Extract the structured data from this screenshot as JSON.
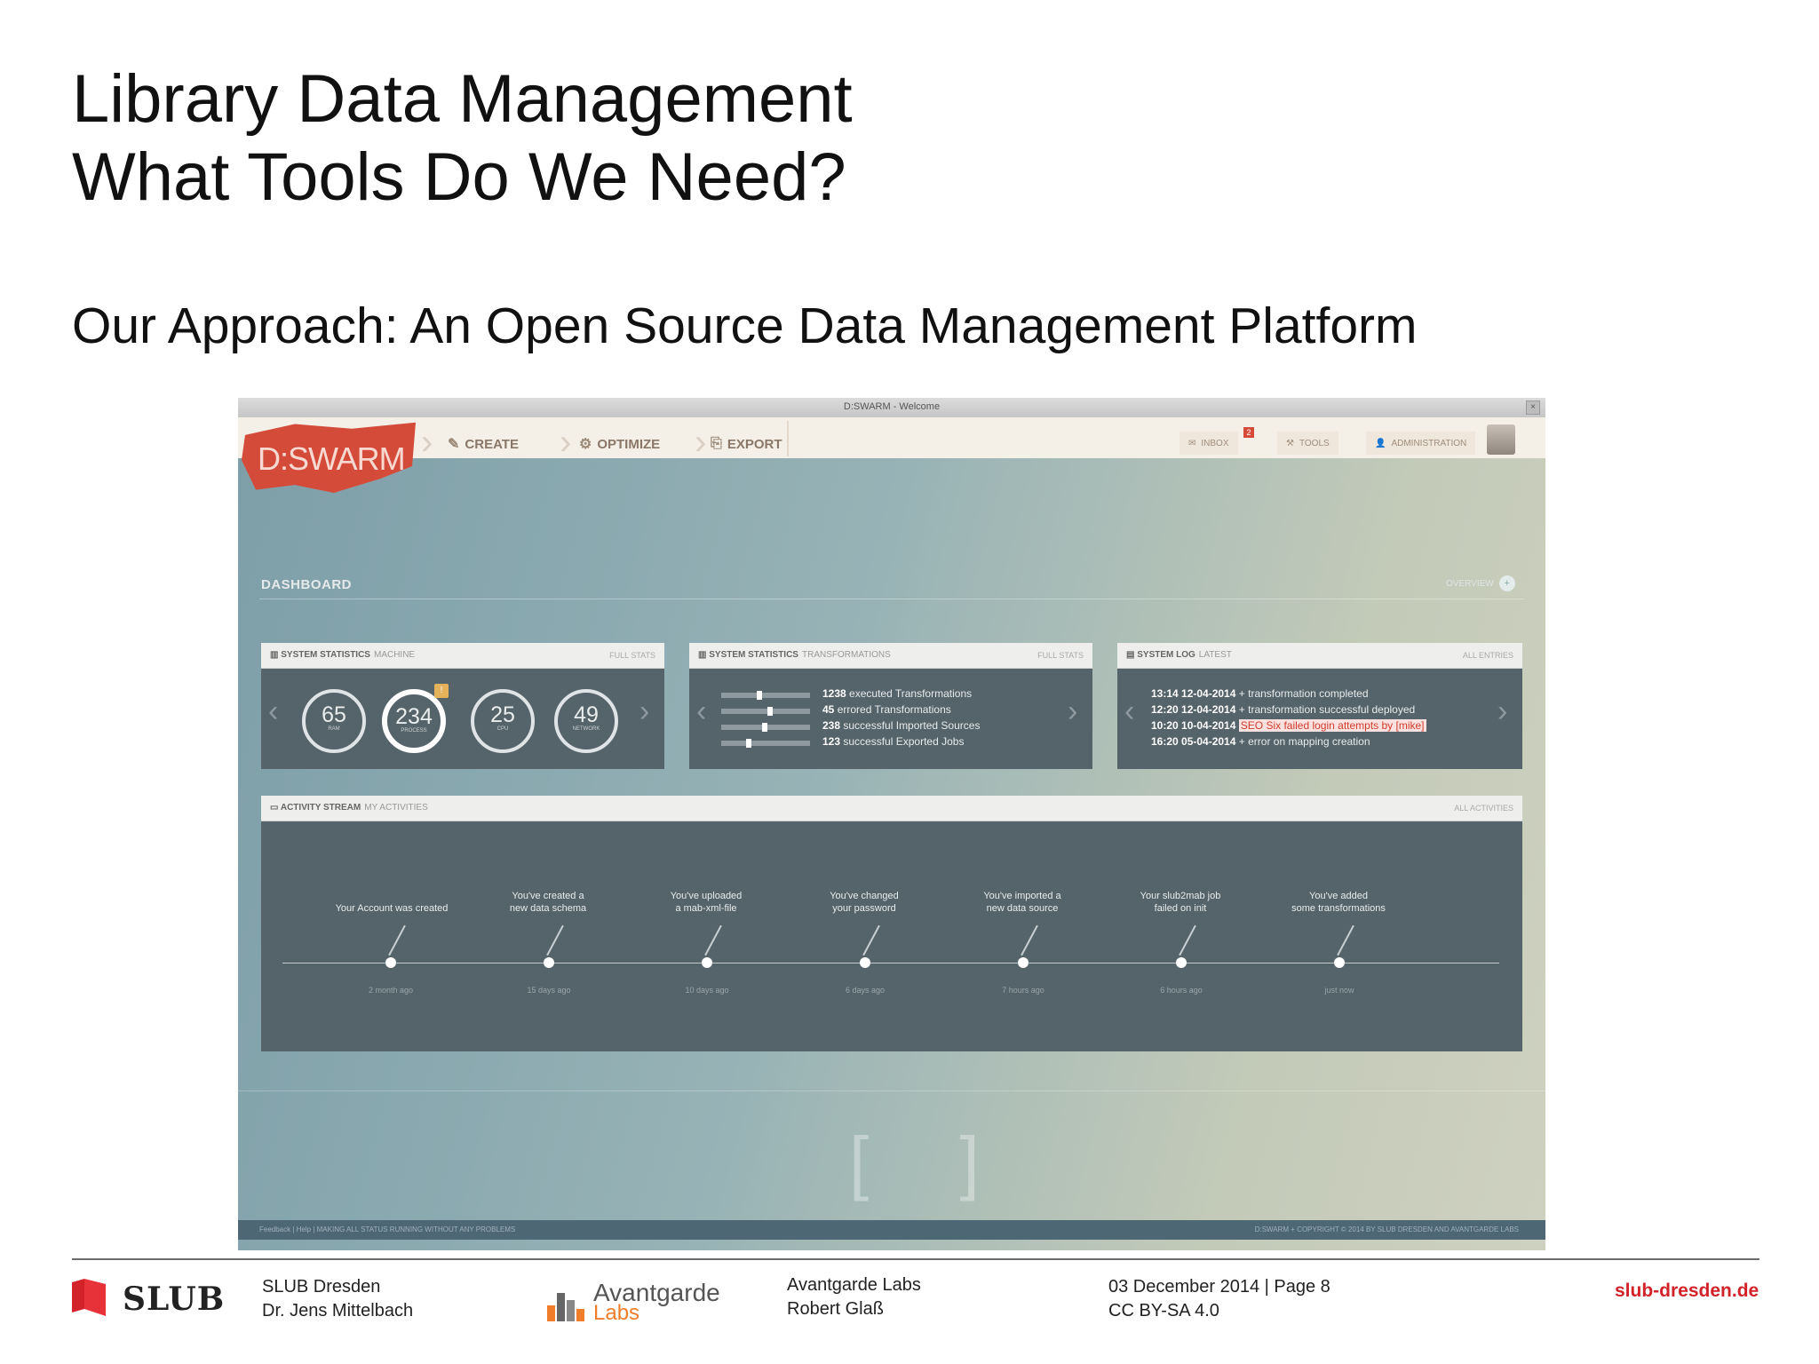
{
  "slide": {
    "title_line1": "Library Data Management",
    "title_line2": "What Tools Do We Need?",
    "subtitle": "Our Approach: An Open Source Data Management Platform"
  },
  "app": {
    "window_title": "D:SWARM - Welcome",
    "close_symbol": "×",
    "logo": "D:SWARM",
    "nav": [
      {
        "label": "CREATE",
        "icon": "pencil-icon"
      },
      {
        "label": "OPTIMIZE",
        "icon": "gears-icon"
      },
      {
        "label": "EXPORT",
        "icon": "export-icon"
      }
    ],
    "menu": {
      "inbox": {
        "label": "INBOX",
        "badge": "2"
      },
      "tools": "TOOLS",
      "admin": "ADMINISTRATION"
    },
    "dashboard": {
      "title": "DASHBOARD",
      "toggle_label": "OVERVIEW",
      "toggle_symbol": "+"
    },
    "machine_panel": {
      "title": "SYSTEM STATISTICS",
      "subtitle": "MACHINE",
      "link": "FULL STATS",
      "gauges": [
        {
          "value": "65",
          "label": "RAM"
        },
        {
          "value": "234",
          "label": "PROCESS",
          "badge": "!"
        },
        {
          "value": "25",
          "label": "CPU"
        },
        {
          "value": "49",
          "label": "NETWORK"
        }
      ]
    },
    "transformation_panel": {
      "title": "SYSTEM STATISTICS",
      "subtitle": "TRANSFORMATIONS",
      "link": "FULL STATS",
      "lines": [
        {
          "count": "1238",
          "text": "executed Transformations"
        },
        {
          "count": "45",
          "text": "errored Transformations"
        },
        {
          "count": "238",
          "text": "successful Imported Sources"
        },
        {
          "count": "123",
          "text": "successful Exported Jobs"
        }
      ]
    },
    "log_panel": {
      "title": "SYSTEM LOG",
      "subtitle": "LATEST",
      "link": "ALL ENTRIES",
      "entries": [
        {
          "time": "13:14 12-04-2014",
          "text": "+ transformation completed",
          "alert": false
        },
        {
          "time": "12:20 12-04-2014",
          "text": "+ transformation successful deployed",
          "alert": false
        },
        {
          "time": "10:20 10-04-2014",
          "text": "SEO Six failed login attempts by [mike]",
          "alert": true
        },
        {
          "time": "16:20 05-04-2014",
          "text": "+ error on mapping creation",
          "alert": false
        }
      ]
    },
    "activity_panel": {
      "title": "ACTIVITY STREAM",
      "subtitle": "MY ACTIVITIES",
      "link": "ALL ACTIVITIES",
      "events": [
        {
          "line1": "Your Account was created",
          "line2": "",
          "time": "2 month ago"
        },
        {
          "line1": "You've created a",
          "line2": "new data schema",
          "time": "15 days ago"
        },
        {
          "line1": "You've uploaded",
          "line2": "a mab-xml-file",
          "time": "10 days ago"
        },
        {
          "line1": "You've changed",
          "line2": "your password",
          "time": "6 days ago"
        },
        {
          "line1": "You've imported a",
          "line2": "new data source",
          "time": "7 hours ago"
        },
        {
          "line1": "Your slub2mab job",
          "line2": "failed on init",
          "time": "6 hours ago"
        },
        {
          "line1": "You've added",
          "line2": "some transformations",
          "time": "just now"
        }
      ]
    },
    "status": {
      "left": "Feedback | Help | MAKING ALL STATUS RUNNING WITHOUT ANY PROBLEMS",
      "right": "D:SWARM + COPYRIGHT © 2014 BY SLUB DRESDEN AND AVANTGARDE LABS"
    }
  },
  "footer": {
    "slub_word": "SLUB",
    "org_line1": "SLUB Dresden",
    "org_line2": "Dr. Jens Mittelbach",
    "al_word1": "Avantgarde",
    "al_word2": "Labs",
    "partner_line1": "Avantgarde Labs",
    "partner_line2": "Robert Glaß",
    "date_line1": "03 December 2014 | Page 8",
    "date_line2": "CC BY-SA 4.0",
    "site": "slub-dresden.de"
  },
  "colors": {
    "accent": "#d54b3a",
    "slub_red": "#d2232a",
    "labs_orange": "#ef7d2a"
  }
}
